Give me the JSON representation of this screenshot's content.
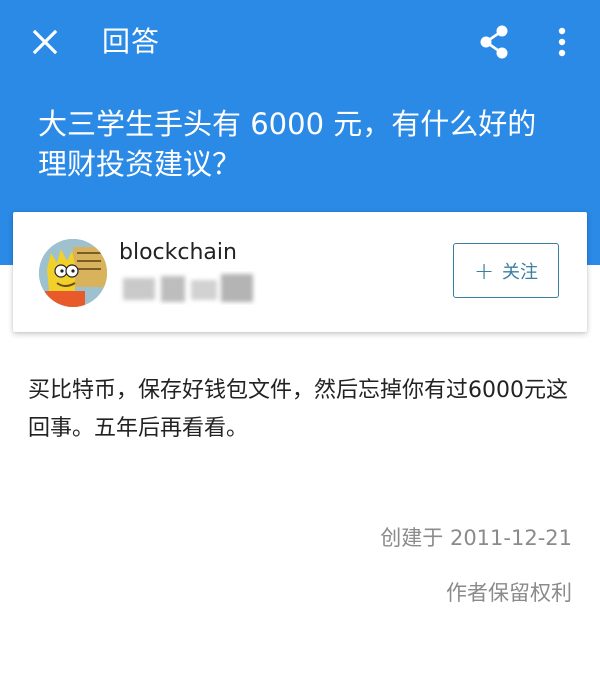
{
  "appbar": {
    "title": "回答",
    "close_icon": "close-icon",
    "share_icon": "share-icon",
    "more_icon": "more-vertical-icon"
  },
  "question": {
    "title": "大三学生手头有 6000 元，有什么好的理财投资建议？"
  },
  "author": {
    "name": "blockchain",
    "follow_label": "关注",
    "follow_icon": "plus-icon"
  },
  "answer": {
    "body": "买比特币，保存好钱包文件，然后忘掉你有过6000元这回事。五年后再看看。",
    "created": "创建于 2011-12-21",
    "rights": "作者保留权利"
  },
  "colors": {
    "header_bg": "#2a8ae6",
    "follow_accent": "#3a7ea2",
    "meta_text": "#8b8b8b"
  }
}
